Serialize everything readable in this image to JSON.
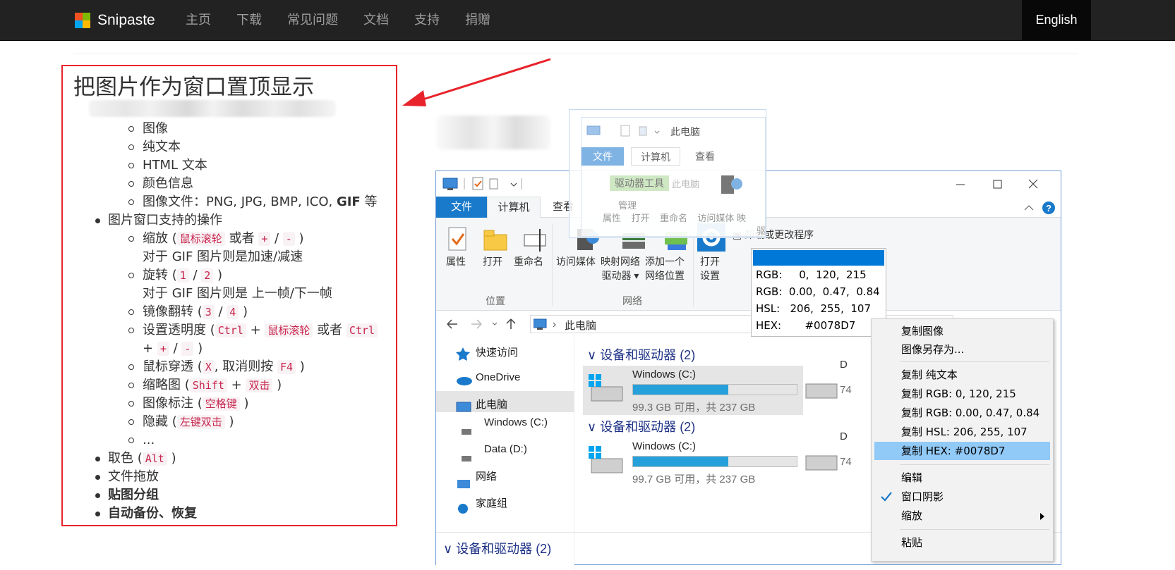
{
  "navbar": {
    "brand": "Snipaste",
    "links": [
      "主页",
      "下载",
      "常见问题",
      "文档",
      "支持",
      "捐赠"
    ],
    "language": "English"
  },
  "content": {
    "heading": "把图片作为窗口置顶显示",
    "sub_items_1": [
      "图像",
      "纯文本",
      "HTML 文本",
      "颜色信息"
    ],
    "image_files_prefix": "图像文件：PNG, JPG, BMP, ICO, ",
    "image_files_gif": "GIF",
    "image_files_suffix": " 等",
    "window_ops": "图片窗口支持的操作",
    "zoom": {
      "label": "缩放 (",
      "key1": "鼠标滚轮",
      "or": " 或者 ",
      "key2": "+",
      "slash": " / ",
      "key3": "-",
      "close": " )",
      "note": "对于 GIF 图片则是加速/减速"
    },
    "rotate": {
      "label": "旋转 (",
      "key1": "1",
      "slash": " / ",
      "key2": "2",
      "close": " )",
      "note": "对于 GIF 图片则是 上一帧/下一帧"
    },
    "mirror": {
      "label": "镜像翻转 (",
      "key1": "3",
      "slash": " / ",
      "key2": "4",
      "close": " )"
    },
    "opacity": {
      "label": "设置透明度 (",
      "key1": "Ctrl",
      "plus": " + ",
      "key2": "鼠标滚轮",
      "or": " 或者 ",
      "key3": "Ctrl",
      "plus2": "+ ",
      "key4": "+",
      "slash": " / ",
      "key5": "-",
      "close": " )"
    },
    "through": {
      "label": "鼠标穿透 (",
      "key1": "X",
      "mid": ", 取消则按 ",
      "key2": "F4",
      "close": " )"
    },
    "thumb": {
      "label": "缩略图 (",
      "key1": "Shift",
      "plus": " + ",
      "key2": "双击",
      "close": " )"
    },
    "annot": {
      "label": "图像标注 (",
      "key1": "空格键",
      "close": " )"
    },
    "hide": {
      "label": "隐藏 (",
      "key1": "左键双击",
      "close": " )"
    },
    "ellipsis": "...",
    "pick": {
      "label": "取色 (",
      "key1": "Alt",
      "close": " )"
    },
    "drag": "文件拖放",
    "group": "贴图分组",
    "backup": "自动备份、恢复"
  },
  "explorer": {
    "tabs": {
      "file": "文件",
      "computer": "计算机",
      "view": "查看"
    },
    "ribbon": {
      "props": "属性",
      "open": "打开",
      "rename": "重命名",
      "media1": "访问媒体",
      "map1": "映射网络",
      "map2": "驱动器",
      "add1": "添加一个",
      "add2": "网络位置",
      "open_settings1": "打开",
      "open_settings2": "设置",
      "uninstall": "卸载或更改程序",
      "group_location": "位置",
      "group_network": "网络"
    },
    "address": "此电脑",
    "nav": [
      "快速访问",
      "OneDrive",
      "此电脑",
      "Windows (C:)",
      "Data (D:)",
      "网络",
      "家庭组"
    ],
    "group_title": "设备和驱动器 (2)",
    "drive1": {
      "name": "Windows (C:)",
      "free": "99.3 GB 可用，共 237 GB",
      "used": 0.58
    },
    "drive2": {
      "name": "Windows (C:)",
      "free": "99.7 GB 可用，共 237 GB",
      "used": 0.58
    },
    "drive_partial": "D",
    "drive_partial_free": "74",
    "drive_partial_free2": "74"
  },
  "ghost": {
    "title": "此电脑",
    "tabs": [
      "文件",
      "计算机",
      "查看"
    ],
    "tools": "驱动器工具",
    "labels": [
      "属性",
      "打开",
      "重命名",
      "访问媒体",
      "映"
    ],
    "faded": [
      "此电脑",
      "管理",
      "驱"
    ]
  },
  "color_info": {
    "swatch": "#0078D7",
    "rgb": "RGB:     0,  120,  215",
    "rgbf": "RGB:  0.00,  0.47,  0.84",
    "hsl": "HSL:   206,  255,  107",
    "hex": "HEX:       #0078D7"
  },
  "context_menu": {
    "items": [
      "复制图像",
      "图像另存为...",
      "复制 纯文本",
      "复制 RGB: 0, 120, 215",
      "复制 RGB: 0.00, 0.47, 0.84",
      "复制 HSL: 206, 255, 107",
      "复制 HEX: #0078D7",
      "编辑",
      "窗口阴影",
      "缩放",
      "粘贴"
    ]
  },
  "colors": {
    "accent_red": "#e8232b",
    "win_blue": "#1979ca",
    "highlight": "#91c9f7",
    "code_red": "#c7254e"
  }
}
